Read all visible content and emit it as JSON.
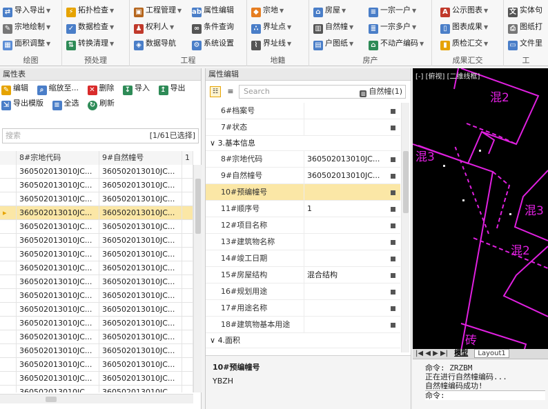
{
  "ribbon": {
    "groups": [
      {
        "label": "绘图",
        "items": [
          "导入导出",
          "宗地绘制",
          "面积调整"
        ]
      },
      {
        "label": "预处理",
        "items": [
          "拓扑检查",
          "数据检查",
          "转换清理"
        ]
      },
      {
        "label": "工程",
        "items": [
          "工程管理",
          "权利人",
          "数据导航",
          "属性编辑",
          "条件查询",
          "系统设置"
        ]
      },
      {
        "label": "地籍",
        "items": [
          "宗地",
          "界址点",
          "界址线"
        ]
      },
      {
        "label": "房产",
        "items": [
          "房屋",
          "自然幢",
          "户图纸",
          "一宗一户",
          "一宗多户",
          "不动产编码"
        ]
      },
      {
        "label": "成果汇交",
        "items": [
          "公示图表",
          "图表成果",
          "质检汇交"
        ]
      },
      {
        "label": "工",
        "items": [
          "实体句",
          "图纸打",
          "文件里"
        ]
      }
    ]
  },
  "left": {
    "title": "属性表",
    "toolbar1": [
      "编辑",
      "缩放至...",
      "删除",
      "导入",
      "导出"
    ],
    "toolbar2": [
      "导出模版",
      "全选",
      "刷新"
    ],
    "search_placeholder": "搜索",
    "count": "[1/61已选择]",
    "columns": [
      "8#宗地代码",
      "9#自然幢号",
      "1"
    ],
    "rows": [
      [
        "360502013010JC...",
        "360502013010JC..."
      ],
      [
        "360502013010JC...",
        "360502013010JC..."
      ],
      [
        "360502013010JC...",
        "360502013010JC..."
      ],
      [
        "360502013010JC...",
        "360502013010JC..."
      ],
      [
        "360502013010JC...",
        "360502013010JC..."
      ],
      [
        "360502013010JC...",
        "360502013010JC..."
      ],
      [
        "360502013010JC...",
        "360502013010JC..."
      ],
      [
        "360502013010JC...",
        "360502013010JC..."
      ],
      [
        "360502013010JC...",
        "360502013010JC..."
      ],
      [
        "360502013010JC...",
        "360502013010JC..."
      ],
      [
        "360502013010JC...",
        "360502013010JC..."
      ],
      [
        "360502013010JC...",
        "360502013010JC..."
      ],
      [
        "360502013010JC...",
        "360502013010JC..."
      ],
      [
        "360502013010JC...",
        "360502013010JC..."
      ],
      [
        "360502013010JC...",
        "360502013010JC..."
      ],
      [
        "360502013010JC...",
        "360502013010JC..."
      ],
      [
        "360502013010JC...",
        "360502013010JC..."
      ]
    ]
  },
  "mid": {
    "title": "属性编辑",
    "search_placeholder": "Search",
    "layer": "自然幢(1)",
    "props_top": [
      {
        "k": "6#档案号",
        "v": ""
      },
      {
        "k": "7#状态",
        "v": ""
      }
    ],
    "cat_basic": "3.基本信息",
    "props_basic": [
      {
        "k": "8#宗地代码",
        "v": "360502013010JC..."
      },
      {
        "k": "9#自然幢号",
        "v": "360502013010JC..."
      },
      {
        "k": "10#预编幢号",
        "v": ""
      },
      {
        "k": "11#顺序号",
        "v": "1"
      },
      {
        "k": "12#项目名称",
        "v": ""
      },
      {
        "k": "13#建筑物名称",
        "v": ""
      },
      {
        "k": "14#竣工日期",
        "v": ""
      },
      {
        "k": "15#房屋结构",
        "v": "混合结构"
      },
      {
        "k": "16#规划用途",
        "v": ""
      },
      {
        "k": "17#用途名称",
        "v": ""
      },
      {
        "k": "18#建筑物基本用途",
        "v": ""
      }
    ],
    "cat_area": "4.面积",
    "desc_title": "10#预编幢号",
    "desc_text": "YBZH"
  },
  "cad": {
    "view_label": "[-] [俯视] [二维线框]",
    "labels": [
      "混2",
      "混3",
      "混3",
      "混2",
      "砖"
    ],
    "tabs": [
      "模型",
      "Layout1"
    ]
  },
  "command": {
    "lines": [
      "命令: ZRZBM",
      "正在进行自然幢编码...",
      "自然幢编码成功!",
      "命令:"
    ]
  },
  "colors": {
    "selection": "#fbe7a6",
    "cad_line": "#e020e0",
    "cad_bg": "#000000"
  }
}
